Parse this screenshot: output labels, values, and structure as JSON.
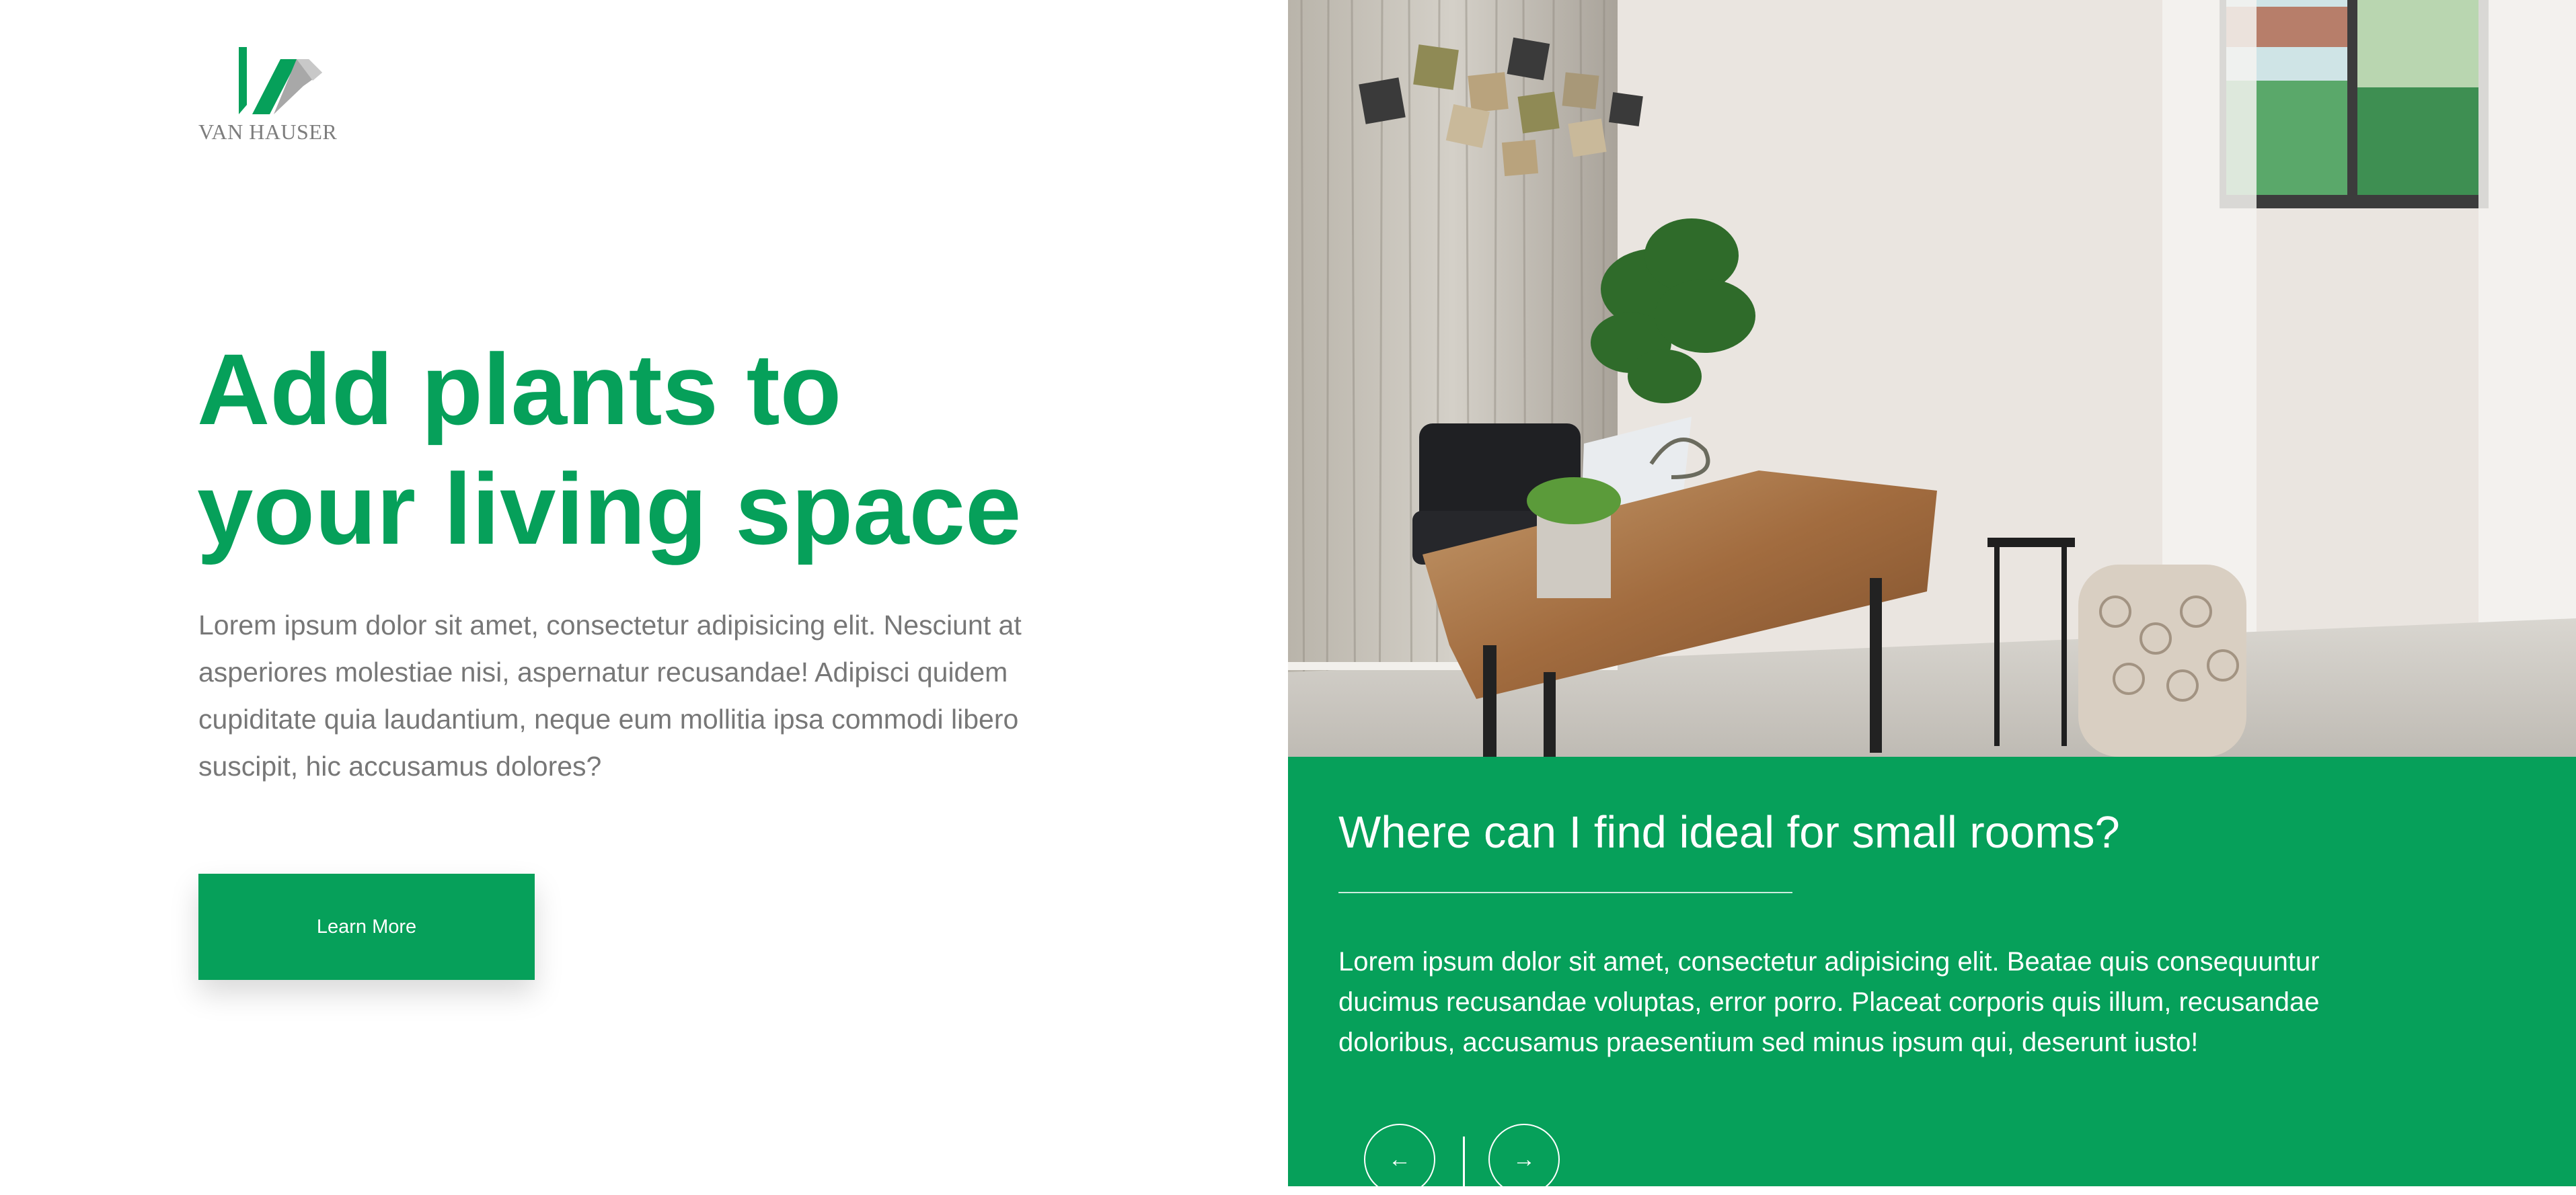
{
  "brand": {
    "name": "VAN HAUSER",
    "logo_icon": "vh-logo-icon",
    "accent": "#06a05a"
  },
  "hero": {
    "title_lines": [
      "Add plants to",
      "your living space"
    ],
    "description": "Lorem ipsum dolor sit amet, consectetur adipisicing elit. Nesciunt at asperiores molestiae nisi, aspernatur recusandae! Adipisci quidem cupiditate quia laudantium, neque eum mollitia ipsa commodi libero suscipit, hic accusamus dolores?",
    "cta_label": "Learn More"
  },
  "photo": {
    "alt": "home office with wooden desk, black chair, plants and window"
  },
  "panel": {
    "title": "Where can I find ideal for small rooms?",
    "text": "Lorem ipsum dolor sit amet, consectetur adipisicing elit. Beatae quis consequuntur ducimus recusandae voluptas, error porro. Placeat corporis quis illum, recusandae doloribus, accusamus praesentium sed minus ipsum qui, deserunt iusto!",
    "prev_icon": "arrow-left-icon",
    "next_icon": "arrow-right-icon"
  },
  "colors": {
    "accent": "#06a05a",
    "body_text": "#777777",
    "logo_gray": "#9e9e9e"
  }
}
